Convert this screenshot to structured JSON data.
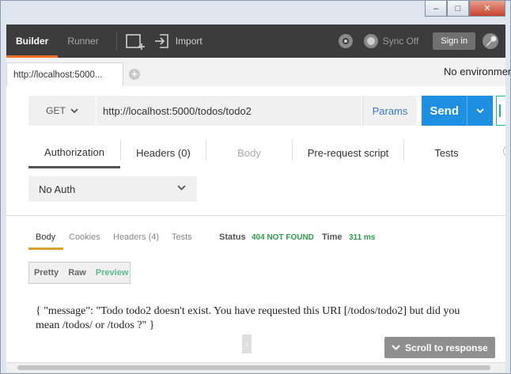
{
  "topbar": {
    "tabs": [
      {
        "label": "Builder",
        "active": true
      },
      {
        "label": "Runner",
        "active": false
      }
    ],
    "import_label": "Import",
    "sync_label": "Sync Off",
    "signin_label": "Sign in",
    "accent_color": "#f47023"
  },
  "tabs": {
    "request_tab": "http://localhost:5000...",
    "add_tab_icon": "plus-circle-icon",
    "environment": "No environment"
  },
  "request": {
    "method": "GET",
    "url": "http://localhost:5000/todos/todo2",
    "params_label": "Params",
    "send_label": "Send",
    "send_color": "#1e8fe1"
  },
  "request_tabs": [
    {
      "label": "Authorization",
      "active": true,
      "disabled": false
    },
    {
      "label": "Headers (0)",
      "active": false,
      "disabled": false
    },
    {
      "label": "Body",
      "active": false,
      "disabled": true
    },
    {
      "label": "Pre-request script",
      "active": false,
      "disabled": false
    },
    {
      "label": "Tests",
      "active": false,
      "disabled": false
    }
  ],
  "auth": {
    "selected": "No Auth"
  },
  "response": {
    "tabs": [
      {
        "label": "Body",
        "active": true
      },
      {
        "label": "Cookies",
        "active": false
      },
      {
        "label": "Headers (4)",
        "active": false
      },
      {
        "label": "Tests",
        "active": false
      }
    ],
    "status_label": "Status",
    "status_value": "404 NOT FOUND",
    "status_color": "#2e9b4a",
    "time_label": "Time",
    "time_value": "311 ms",
    "view_modes": [
      {
        "label": "Pretty",
        "active": false
      },
      {
        "label": "Raw",
        "active": false
      },
      {
        "label": "Preview",
        "active": true
      }
    ],
    "body_line1": "{ \"message\": \"Todo todo2 doesn't exist. You have requested this URI [/todos/todo2] but did you",
    "body_line2": "mean /todos/ or /todos ?\" }",
    "scroll_label": "Scroll to response"
  }
}
